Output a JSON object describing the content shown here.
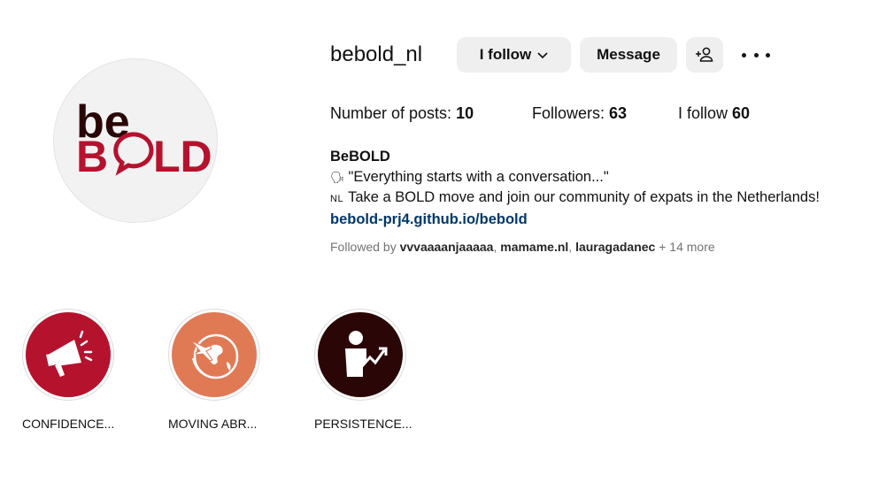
{
  "profile": {
    "username": "bebold_nl",
    "avatar": {
      "logo_top": "be",
      "logo_bottom_left": "B",
      "logo_bottom_right": "LD",
      "brand_dark": "#2a0606",
      "brand_red": "#b5122e"
    }
  },
  "actions": {
    "follow_label": "I follow",
    "message_label": "Message",
    "add_icon": "person-add-icon",
    "more_icon": "more-options-icon"
  },
  "stats": {
    "posts_label": "Number of posts:",
    "posts_value": "10",
    "followers_label": "Followers:",
    "followers_value": "63",
    "following_label": "I follow",
    "following_value": "60"
  },
  "bio": {
    "name": "BeBOLD",
    "line1_emoji": "🗣",
    "line1": "\"Everything starts with a conversation...\"",
    "line2_flag": "NL",
    "line2": "Take a BOLD move and join our community of expats in the Netherlands!",
    "link": "bebold-prj4.github.io/bebold"
  },
  "followed_by": {
    "prefix": "Followed by",
    "users": [
      "vvvaaaanjaaaaa",
      "mamame.nl",
      "lauragadanec"
    ],
    "suffix": "+ 14 more"
  },
  "highlights": [
    {
      "label": "CONFIDENCE...",
      "color": "#b5122e",
      "icon": "megaphone-icon"
    },
    {
      "label": "MOVING ABR...",
      "color": "#e07a55",
      "icon": "globe-plane-icon"
    },
    {
      "label": "PERSISTENCE...",
      "color": "#2a0606",
      "icon": "person-growth-icon"
    }
  ]
}
